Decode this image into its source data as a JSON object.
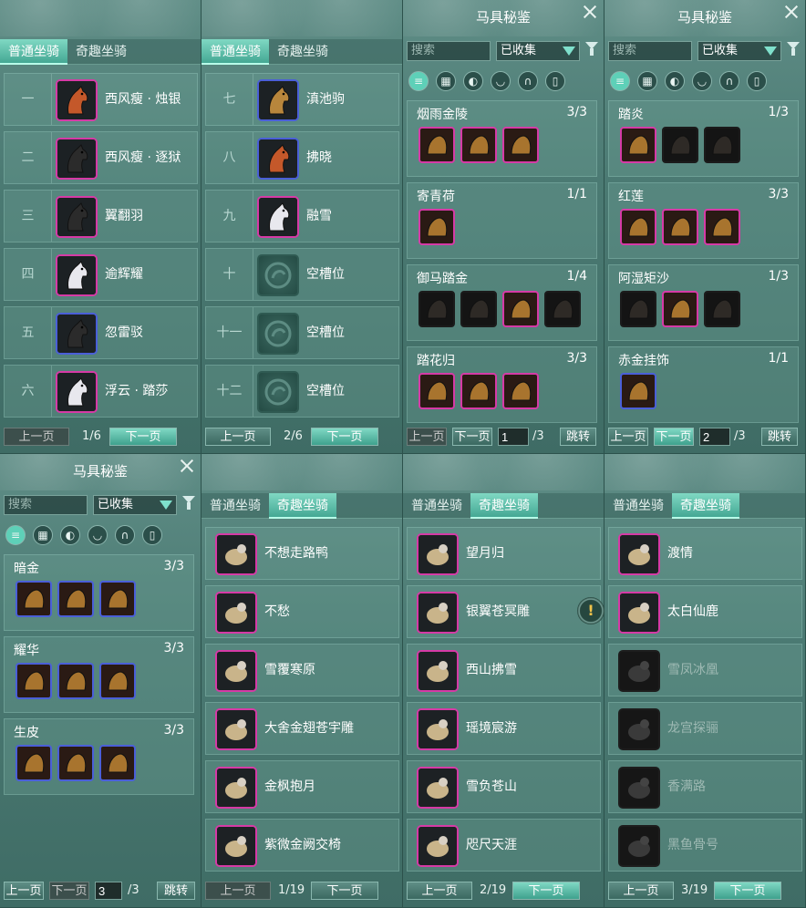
{
  "mount_tabs": {
    "normal": "普通坐骑",
    "fun": "奇趣坐骑"
  },
  "pager": {
    "prev": "上一页",
    "next": "下一页",
    "jump": "跳转"
  },
  "p1": {
    "page": "1/6",
    "rows": [
      {
        "num": "一",
        "name": "西风瘦 · 烛银",
        "color": "purple",
        "icon": "red-horse-icon"
      },
      {
        "num": "二",
        "name": "西风瘦 · 逐狱",
        "color": "purple",
        "icon": "black-horse-icon"
      },
      {
        "num": "三",
        "name": "翼翻羽",
        "color": "purple",
        "icon": "black-horse-icon"
      },
      {
        "num": "四",
        "name": "逾辉耀",
        "color": "purple",
        "icon": "white-horse-icon"
      },
      {
        "num": "五",
        "name": "忽雷驳",
        "color": "blue",
        "icon": "black-horse-icon"
      },
      {
        "num": "六",
        "name": "浮云 · 踏莎",
        "color": "purple",
        "icon": "white-horse-icon"
      }
    ]
  },
  "p2": {
    "page": "2/6",
    "rows": [
      {
        "num": "七",
        "name": "滇池驹",
        "color": "blue",
        "icon": "tan-horse-icon"
      },
      {
        "num": "八",
        "name": "拂晓",
        "color": "blue",
        "icon": "red-horse-icon"
      },
      {
        "num": "九",
        "name": "融雪",
        "color": "purple",
        "icon": "white-horse-icon"
      },
      {
        "num": "十",
        "name": "空槽位",
        "color": "empty",
        "icon": "empty-slot-icon"
      },
      {
        "num": "十一",
        "name": "空槽位",
        "color": "empty",
        "icon": "empty-slot-icon"
      },
      {
        "num": "十二",
        "name": "空槽位",
        "color": "empty",
        "icon": "empty-slot-icon"
      }
    ]
  },
  "codex": {
    "title": "马具秘鉴",
    "search_placeholder": "搜索",
    "filter_value": "已收集",
    "categories": [
      "list",
      "grid",
      "head",
      "saddle",
      "stirrup",
      "armor"
    ]
  },
  "p3": {
    "page_input": "1",
    "total": "/3",
    "groups": [
      {
        "name": "烟雨金陵",
        "count": "3/3",
        "items": [
          "purple",
          "purple",
          "purple"
        ]
      },
      {
        "name": "寄青荷",
        "count": "1/1",
        "items": [
          "purple"
        ]
      },
      {
        "name": "御马踏金",
        "count": "1/4",
        "items": [
          "dark",
          "dark",
          "purple",
          "dark"
        ]
      },
      {
        "name": "踏花归",
        "count": "3/3",
        "items": [
          "purple",
          "purple",
          "purple"
        ]
      }
    ]
  },
  "p4": {
    "page_input": "2",
    "total": "/3",
    "groups": [
      {
        "name": "踏炎",
        "count": "1/3",
        "items": [
          "purple",
          "dark",
          "dark"
        ]
      },
      {
        "name": "红莲",
        "count": "3/3",
        "items": [
          "purple",
          "purple",
          "purple"
        ]
      },
      {
        "name": "阿湿矩沙",
        "count": "1/3",
        "items": [
          "dark",
          "purple",
          "dark"
        ]
      },
      {
        "name": "赤金挂饰",
        "count": "1/1",
        "items": [
          "blue"
        ]
      }
    ]
  },
  "p5": {
    "page_input": "3",
    "total": "/3",
    "groups": [
      {
        "name": "暗金",
        "count": "3/3",
        "items": [
          "blue",
          "blue",
          "blue"
        ]
      },
      {
        "name": "耀华",
        "count": "3/3",
        "items": [
          "blue",
          "blue",
          "blue"
        ]
      },
      {
        "name": "生皮",
        "count": "3/3",
        "items": [
          "blue",
          "blue",
          "blue"
        ]
      }
    ]
  },
  "p6": {
    "page": "1/19",
    "rows": [
      {
        "name": "不想走路鸭",
        "dim": false
      },
      {
        "name": "不愁",
        "dim": false
      },
      {
        "name": "雪覆寒原",
        "dim": false
      },
      {
        "name": "大舍金翅苍宇雕",
        "dim": false
      },
      {
        "name": "金枫抱月",
        "dim": false
      },
      {
        "name": "紫微金阙交椅",
        "dim": false
      }
    ]
  },
  "p7": {
    "page": "2/19",
    "rows": [
      {
        "name": "望月归",
        "dim": false
      },
      {
        "name": "银翼苍冥雕",
        "dim": false
      },
      {
        "name": "西山拂雪",
        "dim": false
      },
      {
        "name": "瑶境宸游",
        "dim": false
      },
      {
        "name": "雪负苍山",
        "dim": false
      },
      {
        "name": "咫尺天涯",
        "dim": false
      }
    ]
  },
  "p8": {
    "page": "3/19",
    "rows": [
      {
        "name": "渡情",
        "dim": false
      },
      {
        "name": "太白仙鹿",
        "dim": false
      },
      {
        "name": "雪凤冰凰",
        "dim": true
      },
      {
        "name": "龙宫探骊",
        "dim": true
      },
      {
        "name": "香满路",
        "dim": true
      },
      {
        "name": "黑鱼骨号",
        "dim": true
      }
    ]
  },
  "warning_glyph": "!"
}
